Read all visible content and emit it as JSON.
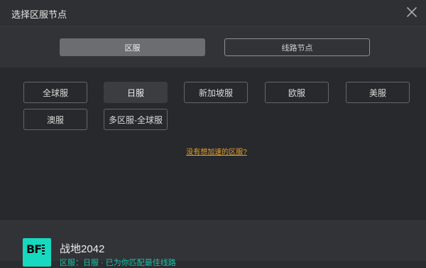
{
  "dialog": {
    "title": "选择区服节点"
  },
  "tabs": [
    {
      "label": "区服",
      "active": true
    },
    {
      "label": "线路节点",
      "active": false
    }
  ],
  "servers": [
    {
      "label": "全球服",
      "selected": false
    },
    {
      "label": "日服",
      "selected": true
    },
    {
      "label": "新加坡服",
      "selected": false
    },
    {
      "label": "欧服",
      "selected": false
    },
    {
      "label": "美服",
      "selected": false
    },
    {
      "label": "澳服",
      "selected": false
    },
    {
      "label": "多区服-全球服",
      "selected": false
    }
  ],
  "help_link": "没有想加速的区服?",
  "game": {
    "name": "战地2042",
    "logo_text": "BF",
    "subtitle": "区服：日服 · 已为你匹配最佳线路"
  },
  "colors": {
    "accent_link": "#e3a02c",
    "game_accent": "#17d9bf"
  }
}
